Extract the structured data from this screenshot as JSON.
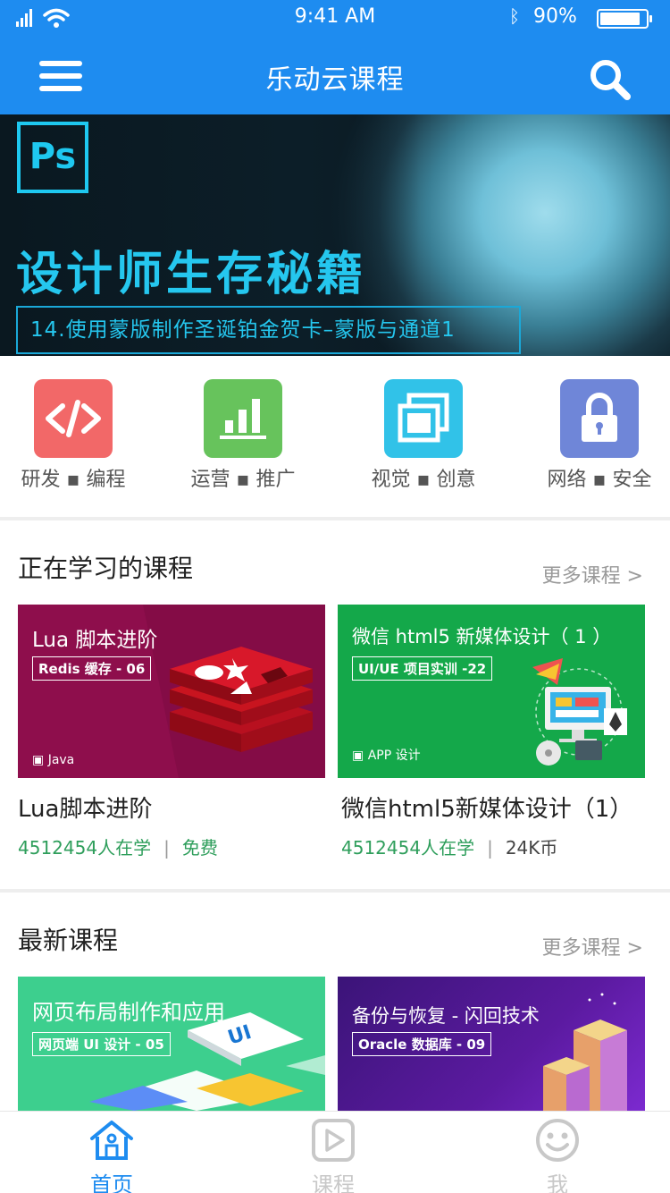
{
  "status_bar": {
    "time": "9:41 AM",
    "battery": "90%"
  },
  "nav": {
    "title": "乐动云课程"
  },
  "banner": {
    "logo_text": "Ps",
    "headline": "设计师生存秘籍",
    "subtitle": "14.使用蒙版制作圣诞铂金贺卡–蒙版与通道1"
  },
  "categories": [
    {
      "label": "研发 ▪ 编程",
      "color": "#f26868",
      "icon": "code-icon"
    },
    {
      "label": "运营 ▪ 推广",
      "color": "#67c35c",
      "icon": "bar-chart-icon"
    },
    {
      "label": "视觉 ▪ 创意",
      "color": "#31c2e8",
      "icon": "layers-icon"
    },
    {
      "label": "网络 ▪ 安全",
      "color": "#6f86d8",
      "icon": "lock-icon"
    }
  ],
  "learning": {
    "title": "正在学习的课程",
    "more": "更多课程 >",
    "cards": [
      {
        "image_caption": "Lua 脚本进阶",
        "image_tag": "Redis 缓存 - 06",
        "image_footer": "Java",
        "title": "Lua脚本进阶",
        "learners": "4512454人在学",
        "price": "免费"
      },
      {
        "image_caption": "微信 html5 新媒体设计（ 1 ）",
        "image_tag": "UI/UE 项目实训 -22",
        "image_footer": "APP 设计",
        "title": "微信html5新媒体设计（1）",
        "learners": "4512454人在学",
        "price": "24K币"
      }
    ]
  },
  "latest": {
    "title": "最新课程",
    "more": "更多课程 >",
    "cards": [
      {
        "image_caption": "网页布局制作和应用",
        "image_tag": "网页端 UI 设计 - 05"
      },
      {
        "image_caption": "备份与恢复 - 闪回技术",
        "image_tag": "Oracle 数据库 - 09"
      }
    ]
  },
  "tab_bar": {
    "items": [
      {
        "label": "首页",
        "active": true
      },
      {
        "label": "课程",
        "active": false
      },
      {
        "label": "我",
        "active": false
      }
    ],
    "active_color": "#1e8cf0",
    "inactive_color": "#c8c8c8"
  }
}
